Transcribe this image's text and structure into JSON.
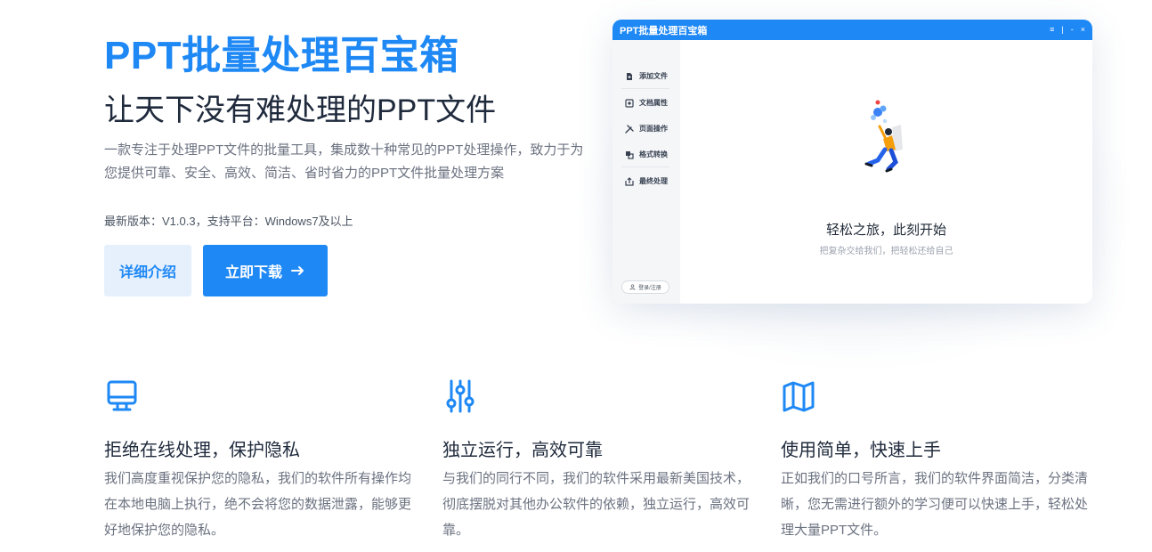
{
  "hero": {
    "title": "PPT批量处理百宝箱",
    "subtitle": "让天下没有难处理的PPT文件",
    "description": "一款专注于处理PPT文件的批量工具，集成数十种常见的PPT处理操作，致力于为您提供可靠、安全、高效、简洁、省时省力的PPT文件批量处理方案",
    "version": "最新版本：V1.0.3，支持平台：Windows7及以上",
    "detail_button": "详细介绍",
    "download_button": "立即下载"
  },
  "app": {
    "title": "PPT批量处理百宝箱",
    "controls": [
      "≡",
      "|",
      "-",
      "×"
    ],
    "sidebar": [
      {
        "label": "添加文件",
        "icon": "file-add-icon"
      },
      {
        "label": "文档属性",
        "icon": "document-properties-icon"
      },
      {
        "label": "页面操作",
        "icon": "tools-icon"
      },
      {
        "label": "格式转换",
        "icon": "convert-icon"
      },
      {
        "label": "最终处理",
        "icon": "export-icon"
      }
    ],
    "login_label": "登录/注册",
    "empty_title": "轻松之旅，此刻开始",
    "empty_subtitle": "把复杂交给我们，把轻松还给自己"
  },
  "features": [
    {
      "icon": "monitor-icon",
      "title": "拒绝在线处理，保护隐私",
      "text": "我们高度重视保护您的隐私，我们的软件所有操作均在本地电脑上执行，绝不会将您的数据泄露，能够更好地保护您的隐私。"
    },
    {
      "icon": "sliders-icon",
      "title": "独立运行，高效可靠",
      "text": "与我们的同行不同，我们的软件采用最新美国技术，彻底摆脱对其他办公软件的依赖，独立运行，高效可靠。"
    },
    {
      "icon": "map-icon",
      "title": "使用简单，快速上手",
      "text": "正如我们的口号所言，我们的软件界面简洁，分类清晰，您无需进行额外的学习便可以快速上手，轻松处理大量PPT文件。"
    }
  ],
  "colors": {
    "accent": "#1e88f5",
    "accent_light": "#e6f0fd",
    "text_dark": "#1f2a3c",
    "text_muted": "#6b7280"
  }
}
